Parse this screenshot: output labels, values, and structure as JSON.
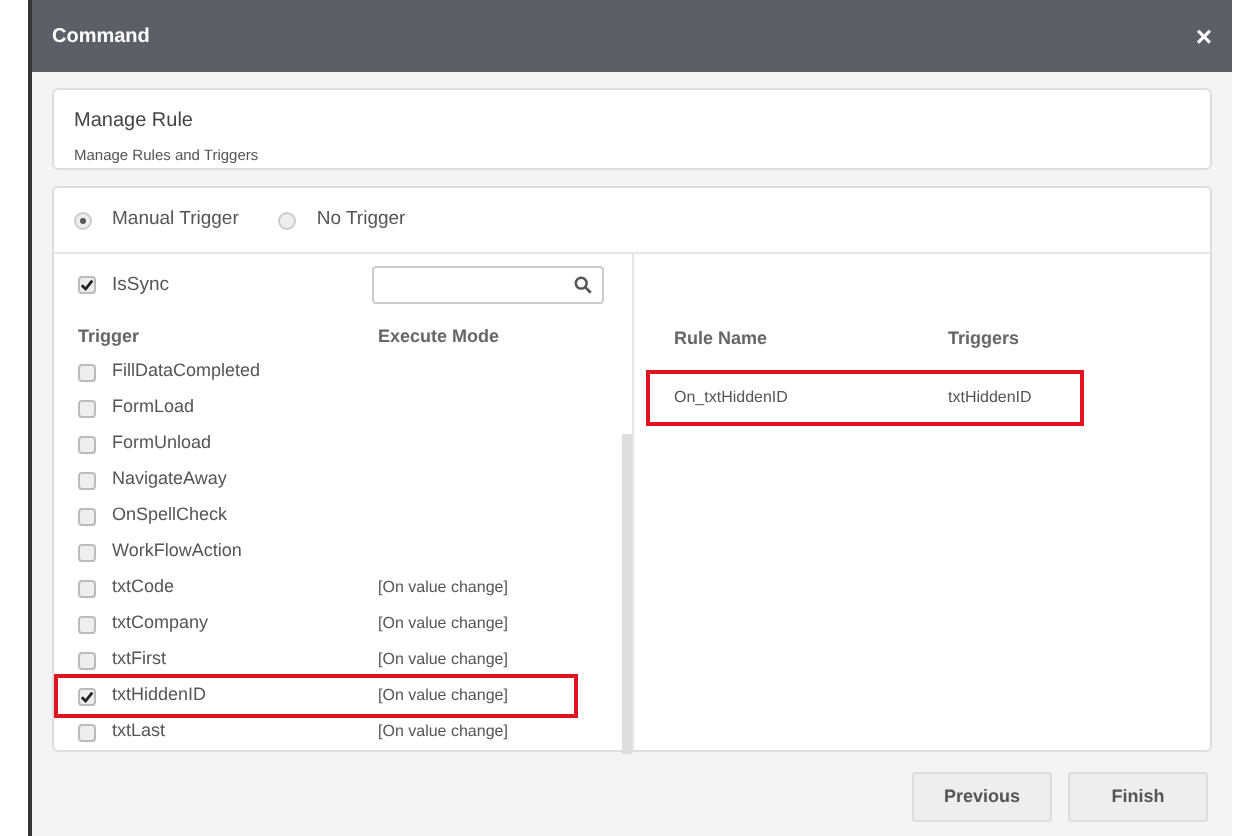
{
  "window": {
    "title": "Command",
    "close": "×"
  },
  "header": {
    "title": "Manage Rule",
    "subtitle": "Manage Rules and Triggers"
  },
  "trigger_modes": [
    {
      "label": "Manual Trigger",
      "selected": true
    },
    {
      "label": "No Trigger",
      "selected": false
    }
  ],
  "is_sync": {
    "label": "IsSync",
    "checked": true
  },
  "trigger_table": {
    "columns": [
      "Trigger",
      "Execute Mode"
    ],
    "rows": [
      {
        "name": "FillDataCompleted",
        "checked": false,
        "highlighted": false
      },
      {
        "name": "FormLoad",
        "checked": false,
        "highlighted": false
      },
      {
        "name": "FormUnload",
        "checked": false,
        "highlighted": false
      },
      {
        "name": "NavigateAway",
        "checked": false,
        "highlighted": false
      },
      {
        "name": "OnSpellCheck",
        "checked": false,
        "highlighted": false
      },
      {
        "name": "WorkFlowAction",
        "checked": false,
        "highlighted": false
      },
      {
        "name": "txtCode",
        "checked": false,
        "mode": "[On value change]",
        "highlighted": false
      },
      {
        "name": "txtCompany",
        "checked": false,
        "mode": "[On value change]",
        "highlighted": false
      },
      {
        "name": "txtFirst",
        "checked": false,
        "mode": "[On value change]",
        "highlighted": false
      },
      {
        "name": "txtHiddenID",
        "checked": true,
        "mode": "[On value change]",
        "highlighted": true
      },
      {
        "name": "txtLast",
        "checked": false,
        "mode": "[On value change]",
        "highlighted": false
      }
    ]
  },
  "rules_table": {
    "columns": [
      "Rule Name",
      "Triggers"
    ],
    "rows": [
      {
        "rule_name": "On_txtHiddenID",
        "triggers": "txtHiddenID",
        "highlighted": true
      }
    ]
  },
  "buttons": [
    "Previous",
    "Finish"
  ]
}
